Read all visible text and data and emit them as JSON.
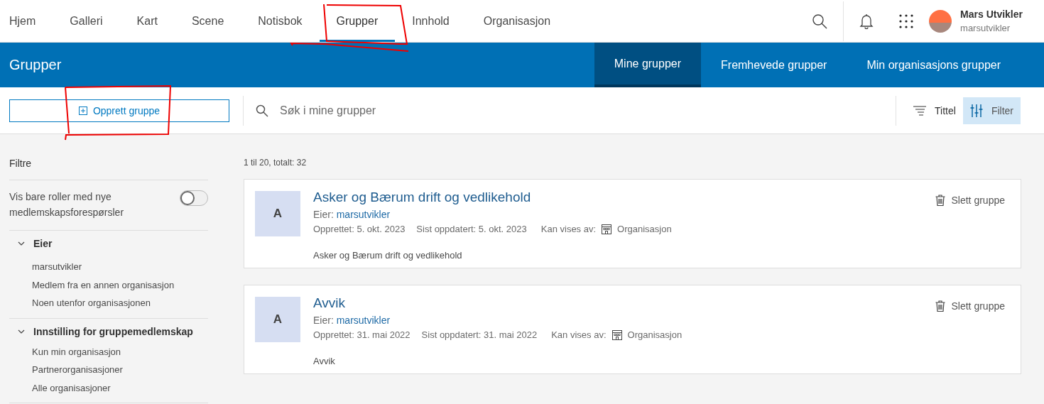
{
  "nav": {
    "items": [
      {
        "label": "Hjem",
        "selected": false
      },
      {
        "label": "Galleri",
        "selected": false
      },
      {
        "label": "Kart",
        "selected": false
      },
      {
        "label": "Scene",
        "selected": false
      },
      {
        "label": "Notisbok",
        "selected": false
      },
      {
        "label": "Grupper",
        "selected": true
      },
      {
        "label": "Innhold",
        "selected": false
      },
      {
        "label": "Organisasjon",
        "selected": false
      }
    ],
    "user": {
      "name": "Mars Utvikler",
      "username": "marsutvikler"
    }
  },
  "subheader": {
    "title": "Grupper",
    "tabs": [
      {
        "label": "Mine grupper",
        "selected": true
      },
      {
        "label": "Fremhevede grupper",
        "selected": false
      },
      {
        "label": "Min organisasjons grupper",
        "selected": false
      }
    ]
  },
  "toolbar": {
    "create_button": "Opprett gruppe",
    "search": {
      "placeholder": "Søk i mine grupper"
    },
    "sort": "Tittel",
    "filter": {
      "label": "Filter",
      "selected": true
    }
  },
  "sidebar": {
    "title": "Filtre",
    "toggle": {
      "label": "Vis bare roller med nye medlemskapsforespørsler",
      "on": false
    },
    "sections": [
      {
        "title": "Eier",
        "expanded": true,
        "items": [
          "marsutvikler",
          "Medlem fra en annen organisasjon",
          "Noen utenfor organisasjonen"
        ]
      },
      {
        "title": "Innstilling for gruppemedlemskap",
        "expanded": true,
        "items": [
          "Kun min organisasjon",
          "Partnerorganisasjoner",
          "Alle organisasjoner"
        ]
      }
    ]
  },
  "results": {
    "count": "1 til 20, totalt: 32",
    "groups": [
      {
        "initial": "A",
        "title": "Asker og Bærum drift og vedlikehold",
        "owner_label": "Eier:",
        "owner": "marsutvikler",
        "created": "Opprettet: 5. okt. 2023",
        "updated": "Sist oppdatert: 5. okt. 2023",
        "visibility_label": "Kan vises av:",
        "visibility": "Organisasjon",
        "description": "Asker og Bærum drift og vedlikehold",
        "delete": "Slett gruppe"
      },
      {
        "initial": "A",
        "title": "Avvik",
        "owner_label": "Eier:",
        "owner": "marsutvikler",
        "created": "Opprettet: 31. mai 2022",
        "updated": "Sist oppdatert: 31. mai 2022",
        "visibility_label": "Kan vises av:",
        "visibility": "Organisasjon",
        "description": "Avvik",
        "delete": "Slett gruppe"
      }
    ]
  }
}
